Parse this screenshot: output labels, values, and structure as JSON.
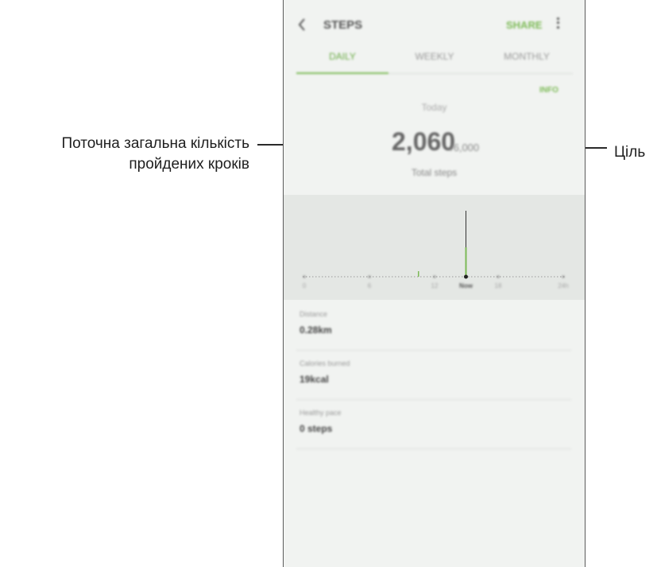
{
  "callouts": {
    "left_line1": "Поточна загальна кількість",
    "left_line2": "пройдених кроків",
    "right": "Ціль"
  },
  "app": {
    "title": "STEPS",
    "action": "SHARE",
    "tabs": [
      {
        "label": "DAILY",
        "active": true
      },
      {
        "label": "WEEKLY",
        "active": false
      },
      {
        "label": "MONTHLY",
        "active": false
      }
    ]
  },
  "summary": {
    "goal_badge": "INFO",
    "day_label": "Today",
    "steps": "2,060",
    "goal": "/6,000",
    "total": "Total steps"
  },
  "chart": {
    "ticks": [
      {
        "label": "0",
        "now": false
      },
      {
        "label": "6",
        "now": false
      },
      {
        "label": "12",
        "now": false
      },
      {
        "label": "Now",
        "now": true
      },
      {
        "label": "18",
        "now": false
      },
      {
        "label": "24h",
        "now": false
      }
    ]
  },
  "stats": [
    {
      "label": "Distance",
      "value": "0.28km"
    },
    {
      "label": "Calories burned",
      "value": "19kcal"
    },
    {
      "label": "Healthy pace",
      "value": "0 steps"
    }
  ],
  "colors": {
    "accent": "#7cba56",
    "screen_bg": "#f1f3f1"
  }
}
